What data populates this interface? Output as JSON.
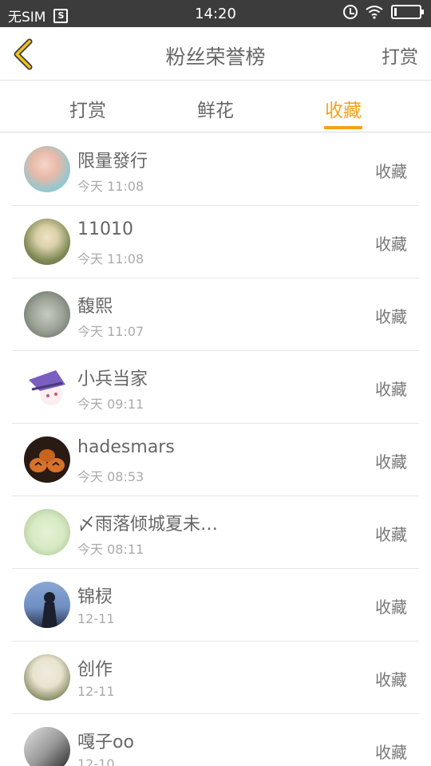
{
  "status_bar": {
    "carrier": "无SIM",
    "time": "14:20",
    "sim_icon": "S"
  },
  "header": {
    "title": "粉丝荣誉榜",
    "right_action": "打赏"
  },
  "tabs": [
    {
      "label": "打赏",
      "active": false
    },
    {
      "label": "鲜花",
      "active": false
    },
    {
      "label": "收藏",
      "active": true
    }
  ],
  "accent_color": "#f3a316",
  "list": [
    {
      "name": "限量發行",
      "time": "今天 11:08",
      "action": "收藏",
      "avatar_colors": [
        "#f6d6c8",
        "#8fc8d0"
      ]
    },
    {
      "name": "11010",
      "time": "今天 11:08",
      "action": "收藏",
      "avatar_colors": [
        "#d9cfa8",
        "#5d6a3d"
      ]
    },
    {
      "name": "馥熙",
      "time": "今天 11:07",
      "action": "收藏",
      "avatar_colors": [
        "#b7bdb2",
        "#5c6457"
      ]
    },
    {
      "name": "小兵当家",
      "time": "今天 09:11",
      "action": "收藏",
      "avatar_colors": [
        "#ffffff",
        "#7a5fc0"
      ]
    },
    {
      "name": "hadesmars",
      "time": "今天 08:53",
      "action": "收藏",
      "avatar_colors": [
        "#2a1a14",
        "#d8722a"
      ]
    },
    {
      "name": "〆雨落倾城夏未…",
      "time": "今天 08:11",
      "action": "收藏",
      "avatar_colors": [
        "#d7e9c4",
        "#9fbf86"
      ]
    },
    {
      "name": "锦棂",
      "time": "12-11",
      "action": "收藏",
      "avatar_colors": [
        "#6f8fc2",
        "#1b1f2e"
      ]
    },
    {
      "name": "创作",
      "time": "12-11",
      "action": "收藏",
      "avatar_colors": [
        "#e8e2cf",
        "#55603b"
      ]
    },
    {
      "name": "嘎子oo",
      "time": "12-10",
      "action": "收藏",
      "avatar_colors": [
        "#e0e0e0",
        "#222222"
      ]
    }
  ]
}
